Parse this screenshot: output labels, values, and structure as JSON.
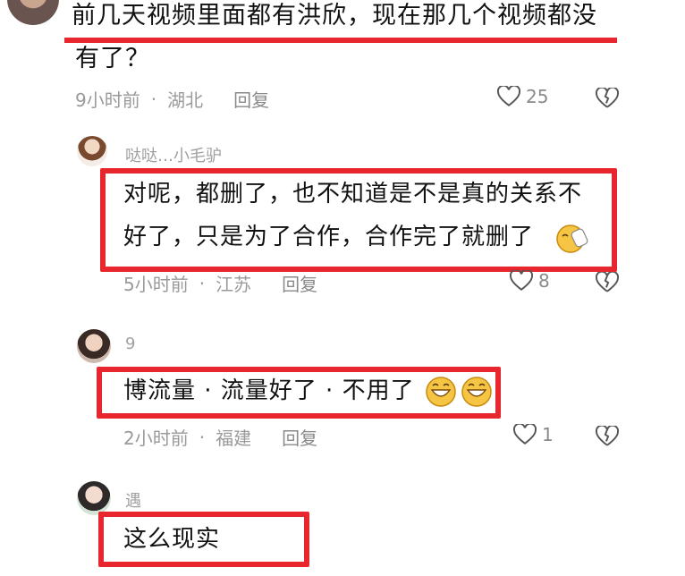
{
  "comment_main": {
    "text_line1": "前几天视频里面都有洪欣，现在那几个视频都没",
    "text_line2": "有了？",
    "time": "9小时前",
    "location": "湖北",
    "reply_label": "回复",
    "likes": "25"
  },
  "replies": [
    {
      "user": "哒哒…小毛驴",
      "text_line1": "对呢，都删了，也不知道是不是真的关系不",
      "text_line2": "好了，只是为了合作，合作完了就删了",
      "time": "5小时前",
      "location": "江苏",
      "reply_label": "回复",
      "likes": "8"
    },
    {
      "user": "9",
      "text": "博流量 · 流量好了 · 不用了",
      "time": "2小时前",
      "location": "福建",
      "reply_label": "回复",
      "likes": "1"
    },
    {
      "user": "遇",
      "text": "这么现实"
    }
  ],
  "colors": {
    "highlight": "#e8262d",
    "meta": "#9a9a9a"
  }
}
